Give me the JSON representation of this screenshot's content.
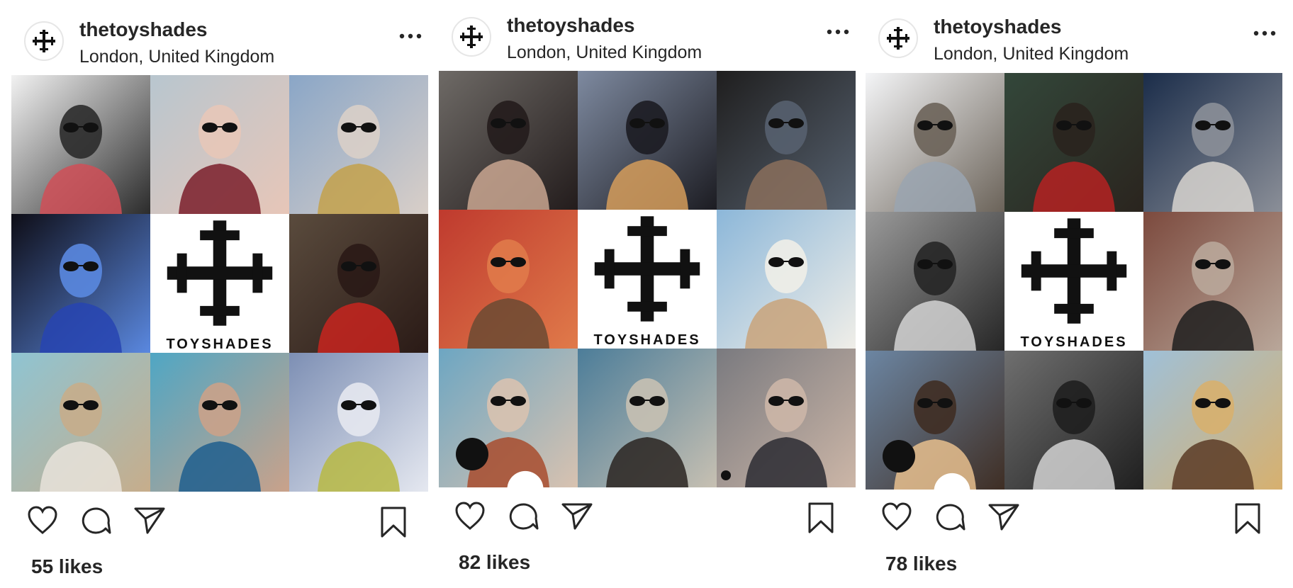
{
  "posts": [
    {
      "username": "thetoyshades",
      "location": "London, United Kingdom",
      "brand_text": "TOYSHADES",
      "likes": "55 likes",
      "tiles": [
        {
          "type": "photo",
          "colors": [
            "#f2f2f2",
            "#d04f57",
            "#2b2b2b"
          ]
        },
        {
          "type": "photo",
          "colors": [
            "#b8c6cf",
            "#7a1d2a",
            "#e7c6b8"
          ]
        },
        {
          "type": "photo",
          "colors": [
            "#8aa6c7",
            "#c3a14b",
            "#d9cfc8"
          ]
        },
        {
          "type": "photo",
          "colors": [
            "#0e0d16",
            "#2744b2",
            "#5a88e0"
          ]
        },
        {
          "type": "brand"
        },
        {
          "type": "photo",
          "colors": [
            "#5a4b3d",
            "#c8241e",
            "#2a1a16"
          ]
        },
        {
          "type": "photo",
          "colors": [
            "#8fc4d2",
            "#e8e3da",
            "#c7ad8b"
          ]
        },
        {
          "type": "photo",
          "colors": [
            "#4fa6c4",
            "#1e5f8e",
            "#caa28a"
          ]
        },
        {
          "type": "photo",
          "colors": [
            "#7d8fb4",
            "#b7b843",
            "#e5e8f0"
          ]
        }
      ],
      "user_tag": "none"
    },
    {
      "username": "thetoyshades",
      "location": "London, United Kingdom",
      "brand_text": "TOYSHADES",
      "likes": "82 likes",
      "tiles": [
        {
          "type": "photo",
          "colors": [
            "#6e6a66",
            "#c9a690",
            "#231c1c"
          ]
        },
        {
          "type": "photo",
          "colors": [
            "#7e8aa0",
            "#d59c5a",
            "#1c1c22"
          ]
        },
        {
          "type": "photo",
          "colors": [
            "#1f1e1e",
            "#8a6e5c",
            "#56616f"
          ]
        },
        {
          "type": "photo",
          "colors": [
            "#bf3a2e",
            "#6b4a33",
            "#e07a4a"
          ]
        },
        {
          "type": "brand"
        },
        {
          "type": "photo",
          "colors": [
            "#8cb7d9",
            "#c9a37a",
            "#f0eee8"
          ]
        },
        {
          "type": "photo",
          "colors": [
            "#6da6c2",
            "#a84c2e",
            "#d8c2b0"
          ]
        },
        {
          "type": "photo",
          "colors": [
            "#4c7d99",
            "#2a2421",
            "#c7c0b2"
          ]
        },
        {
          "type": "photo",
          "colors": [
            "#7a7a7f",
            "#2b2b33",
            "#ccb6a7"
          ]
        }
      ],
      "user_tag": "both"
    },
    {
      "username": "thetoyshades",
      "location": "London, United Kingdom",
      "brand_text": "TOYSHADES",
      "likes": "78 likes",
      "tiles": [
        {
          "type": "photo",
          "colors": [
            "#f4f5f7",
            "#9aa4b0",
            "#6b6359"
          ]
        },
        {
          "type": "photo",
          "colors": [
            "#33473a",
            "#b52222",
            "#2a241e"
          ]
        },
        {
          "type": "photo",
          "colors": [
            "#1b2d4a",
            "#d7d4cf",
            "#8b8f98"
          ]
        },
        {
          "type": "photo",
          "colors": [
            "#9a9a9a",
            "#d4d4d4",
            "#262626"
          ]
        },
        {
          "type": "brand"
        },
        {
          "type": "photo",
          "colors": [
            "#7c4a3e",
            "#1e1e1e",
            "#b9a79a"
          ]
        },
        {
          "type": "photo",
          "colors": [
            "#6c86a3",
            "#e8c08e",
            "#3f2e24"
          ]
        },
        {
          "type": "photo",
          "colors": [
            "#6f6f6f",
            "#d2d2d2",
            "#1f1f1f"
          ]
        },
        {
          "type": "photo",
          "colors": [
            "#9fc0d8",
            "#5b3b26",
            "#d7b06e"
          ]
        }
      ],
      "user_tag": "large"
    }
  ],
  "icons": {
    "logo": "toyshades-cross-logo",
    "more": "more-options-icon",
    "like": "heart-icon",
    "comment": "comment-icon",
    "share": "paper-plane-icon",
    "save": "bookmark-icon",
    "user_tag": "user-tag-icon"
  },
  "colors": {
    "text": "#262626",
    "icon_stroke": "#262626",
    "background": "#ffffff"
  }
}
